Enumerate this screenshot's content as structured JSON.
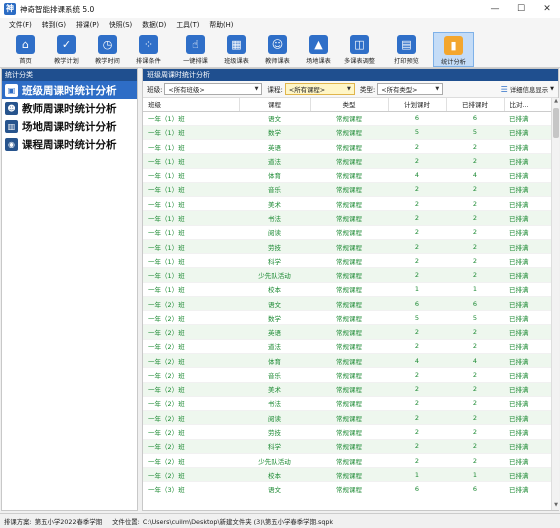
{
  "window": {
    "title": "神奇智能排课系统 5.0",
    "app_icon": "神",
    "minimize": "—",
    "maximize": "☐",
    "close": "✕"
  },
  "menu": [
    "文件(F)",
    "转到(G)",
    "排课(P)",
    "快照(S)",
    "数据(D)",
    "工具(T)",
    "帮助(H)"
  ],
  "toolbar": [
    {
      "label": "首页",
      "icon": "home-icon",
      "glyph": "⌂"
    },
    {
      "label": "教学计划",
      "icon": "clipboard-icon",
      "glyph": "✓"
    },
    {
      "label": "教学时间",
      "icon": "clock-icon",
      "glyph": "◷"
    },
    {
      "label": "排课条件",
      "icon": "dots-grid-icon",
      "glyph": "⁘"
    },
    {
      "label": "一键排课",
      "icon": "hand-pointer-icon",
      "glyph": "☝"
    },
    {
      "label": "班级课表",
      "icon": "calendar-grid-icon",
      "glyph": "▦"
    },
    {
      "label": "教师课表",
      "icon": "teacher-card-icon",
      "glyph": "☺"
    },
    {
      "label": "场地课表",
      "icon": "building-icon",
      "glyph": "▲"
    },
    {
      "label": "多课表调整",
      "icon": "multi-table-icon",
      "glyph": "◫"
    },
    {
      "label": "打印预览",
      "icon": "printer-icon",
      "glyph": "▤"
    },
    {
      "label": "统计分析",
      "icon": "bar-chart-icon",
      "glyph": "▮"
    }
  ],
  "left_panel": {
    "header": "统计分类",
    "items": [
      {
        "label": "班级周课时统计分析",
        "icon": "class-icon",
        "glyph": "▣"
      },
      {
        "label": "教师周课时统计分析",
        "icon": "teacher-icon",
        "glyph": "☻"
      },
      {
        "label": "场地周课时统计分析",
        "icon": "venue-icon",
        "glyph": "▥"
      },
      {
        "label": "课程周课时统计分析",
        "icon": "course-icon",
        "glyph": "◉"
      }
    ]
  },
  "right_panel": {
    "header": "班级周课时统计分析",
    "filters": {
      "class_label": "班级:",
      "class_value": "<所有班级>",
      "course_label": "课程:",
      "course_value": "<所有课程>",
      "type_label": "类型:",
      "type_value": "<所有类型>",
      "detail_label": "详细信息显示"
    },
    "table": {
      "columns": [
        "班级",
        "课程",
        "类型",
        "计划课时",
        "已排课时",
        "比对..."
      ],
      "rows": [
        [
          "一年（1）班",
          "语文",
          "常规课程",
          "6",
          "6",
          "已排满"
        ],
        [
          "一年（1）班",
          "数学",
          "常规课程",
          "5",
          "5",
          "已排满"
        ],
        [
          "一年（1）班",
          "英语",
          "常规课程",
          "2",
          "2",
          "已排满"
        ],
        [
          "一年（1）班",
          "道法",
          "常规课程",
          "2",
          "2",
          "已排满"
        ],
        [
          "一年（1）班",
          "体育",
          "常规课程",
          "4",
          "4",
          "已排满"
        ],
        [
          "一年（1）班",
          "音乐",
          "常规课程",
          "2",
          "2",
          "已排满"
        ],
        [
          "一年（1）班",
          "美术",
          "常规课程",
          "2",
          "2",
          "已排满"
        ],
        [
          "一年（1）班",
          "书法",
          "常规课程",
          "2",
          "2",
          "已排满"
        ],
        [
          "一年（1）班",
          "阅读",
          "常规课程",
          "2",
          "2",
          "已排满"
        ],
        [
          "一年（1）班",
          "劳技",
          "常规课程",
          "2",
          "2",
          "已排满"
        ],
        [
          "一年（1）班",
          "科学",
          "常规课程",
          "2",
          "2",
          "已排满"
        ],
        [
          "一年（1）班",
          "少先队活动",
          "常规课程",
          "2",
          "2",
          "已排满"
        ],
        [
          "一年（1）班",
          "校本",
          "常规课程",
          "1",
          "1",
          "已排满"
        ],
        [
          "一年（2）班",
          "语文",
          "常规课程",
          "6",
          "6",
          "已排满"
        ],
        [
          "一年（2）班",
          "数学",
          "常规课程",
          "5",
          "5",
          "已排满"
        ],
        [
          "一年（2）班",
          "英语",
          "常规课程",
          "2",
          "2",
          "已排满"
        ],
        [
          "一年（2）班",
          "道法",
          "常规课程",
          "2",
          "2",
          "已排满"
        ],
        [
          "一年（2）班",
          "体育",
          "常规课程",
          "4",
          "4",
          "已排满"
        ],
        [
          "一年（2）班",
          "音乐",
          "常规课程",
          "2",
          "2",
          "已排满"
        ],
        [
          "一年（2）班",
          "美术",
          "常规课程",
          "2",
          "2",
          "已排满"
        ],
        [
          "一年（2）班",
          "书法",
          "常规课程",
          "2",
          "2",
          "已排满"
        ],
        [
          "一年（2）班",
          "阅读",
          "常规课程",
          "2",
          "2",
          "已排满"
        ],
        [
          "一年（2）班",
          "劳技",
          "常规课程",
          "2",
          "2",
          "已排满"
        ],
        [
          "一年（2）班",
          "科学",
          "常规课程",
          "2",
          "2",
          "已排满"
        ],
        [
          "一年（2）班",
          "少先队活动",
          "常规课程",
          "2",
          "2",
          "已排满"
        ],
        [
          "一年（2）班",
          "校本",
          "常规课程",
          "1",
          "1",
          "已排满"
        ],
        [
          "一年（3）班",
          "语文",
          "常规课程",
          "6",
          "6",
          "已排满"
        ],
        [
          "一年（3）班",
          "数学",
          "常规课程",
          "5",
          "5",
          "已排满"
        ]
      ]
    }
  },
  "status": {
    "plan_label": "排课方案:",
    "plan_value": "第五小学2022春季学期",
    "file_label": "文件位置:",
    "file_value": "C:\\Users\\cuilm\\Desktop\\新建文件夹 (3)\\第五小学春季学期.sqpk"
  },
  "colors": {
    "header_blue": "#1f4f8f",
    "selected_blue": "#2e6dc6",
    "row_text_green": "#1c8a33",
    "accent_orange": "#f3a62e"
  }
}
